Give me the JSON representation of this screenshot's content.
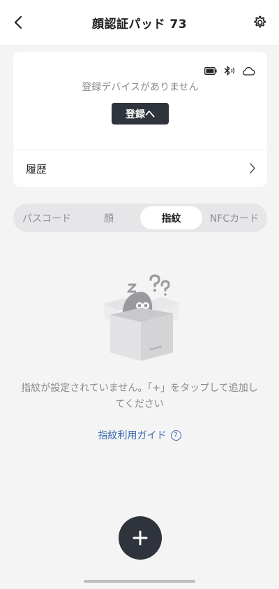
{
  "header": {
    "title": "顔認証パッド 73",
    "back_icon": "chevron-left-icon",
    "settings_icon": "gear-icon"
  },
  "device_card": {
    "status_icons": [
      "battery-icon",
      "bluetooth-icon",
      "cloud-icon"
    ],
    "empty_text": "登録デバイスがありません",
    "register_label": "登録へ",
    "history_label": "履歴"
  },
  "tabs": [
    {
      "label": "パスコード",
      "active": false
    },
    {
      "label": "顔",
      "active": false
    },
    {
      "label": "指紋",
      "active": true
    },
    {
      "label": "NFCカード",
      "active": false
    }
  ],
  "empty_state": {
    "message": "指紋が設定されていません。「+」をタップして追加してください",
    "guide_link": "指紋利用ガイド",
    "help_glyph": "?"
  },
  "fab": {
    "icon": "plus-icon"
  },
  "colors": {
    "accent_dark": "#2f333b",
    "link_blue": "#3b6bb0",
    "background": "#f4f4f5"
  }
}
